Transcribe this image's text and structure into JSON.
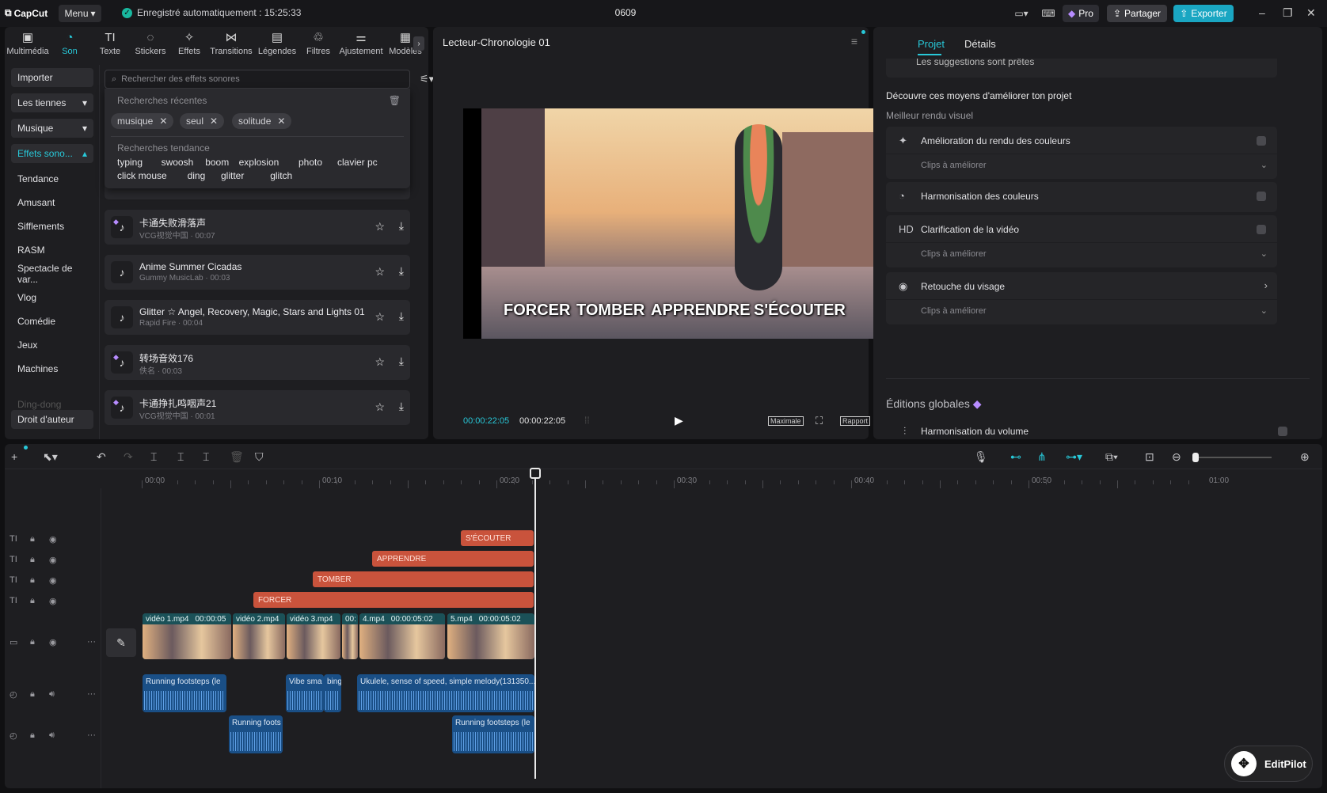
{
  "titlebar": {
    "logo": "CapCut",
    "menu": "Menu",
    "autosave": "Enregistré automatiquement : 15:25:33",
    "project": "0609",
    "pro": "Pro",
    "share": "Partager",
    "export": "Exporter",
    "min": "–",
    "restore": "❐",
    "close": "✕"
  },
  "tabs": [
    {
      "label": "Multimédia",
      "icon": "▣"
    },
    {
      "label": "Son",
      "icon": "◔"
    },
    {
      "label": "Texte",
      "icon": "TI"
    },
    {
      "label": "Stickers",
      "icon": "◌"
    },
    {
      "label": "Effets",
      "icon": "✧"
    },
    {
      "label": "Transitions",
      "icon": "⋈"
    },
    {
      "label": "Légendes",
      "icon": "▤"
    },
    {
      "label": "Filtres",
      "icon": "♲"
    },
    {
      "label": "Ajustement",
      "icon": "⚌"
    },
    {
      "label": "Modèles",
      "icon": "▦"
    }
  ],
  "sidebar": {
    "import": "Importer",
    "yours": "Les tiennes",
    "music": "Musique",
    "sfx": "Effets sono...",
    "cats": [
      "Tendance",
      "Amusant",
      "Sifflements",
      "RASM",
      "Spectacle de var...",
      "Vlog",
      "Comédie",
      "Jeux",
      "Machines"
    ],
    "faded": "Ding-dong",
    "copyright": "Droit d'auteur"
  },
  "search": {
    "placeholder": "Rechercher des effets sonores"
  },
  "dropdown": {
    "recent_title": "Recherches récentes",
    "recent": [
      "musique",
      "seul",
      "solitude"
    ],
    "trend_title": "Recherches tendance",
    "trend_row1": [
      "typing",
      "swoosh",
      "boom",
      "explosion",
      "photo",
      "clavier pc"
    ],
    "trend_row2": [
      "click mouse",
      "ding",
      "glitter",
      "glitch"
    ]
  },
  "sounds": [
    {
      "name": "卡通失败滑落声",
      "sub": "VCG视觉中国 · 00:07",
      "pro": true
    },
    {
      "name": "Anime Summer Cicadas",
      "sub": "Gummy MusicLab · 00:03",
      "pro": false
    },
    {
      "name": "Glitter ☆ Angel, Recovery, Magic, Stars and Lights 01",
      "sub": "Rapid Fire · 00:04",
      "pro": false
    },
    {
      "name": "转场音效176",
      "sub": "佚名 · 00:03",
      "pro": true
    },
    {
      "name": "卡通挣扎鸣咽声21",
      "sub": "VCG视觉中国 · 00:01",
      "pro": true
    }
  ],
  "player": {
    "title": "Lecteur-Chronologie 01",
    "current": "00:00:22:05",
    "total": "00:00:22:05",
    "ratio": "Maximale",
    "report": "Rapport",
    "captions": [
      "FORCER",
      "TOMBER",
      "APPRENDRE",
      "S'ÉCOUTER"
    ]
  },
  "right": {
    "tab_project": "Projet",
    "tab_details": "Détails",
    "top_text": "Les suggestions sont prêtes",
    "discover": "Découvre ces moyens d'améliorer ton projet",
    "visual": "Meilleur rendu visuel",
    "items": [
      {
        "label": "Amélioration du rendu des couleurs",
        "sub": "Clips à améliorer",
        "icon": "✦"
      },
      {
        "label": "Harmonisation des couleurs",
        "icon": "◔"
      },
      {
        "label": "Clarification de la vidéo",
        "sub": "Clips à améliorer",
        "icon": "HD"
      },
      {
        "label": "Retouche du visage",
        "sub": "Clips à améliorer",
        "icon": "◉"
      }
    ],
    "global": "Éditions globales",
    "volume": "Harmonisation du volume"
  },
  "timeline": {
    "ticks": [
      "00:00",
      "00:10",
      "00:20",
      "00:30",
      "00:40",
      "00:50",
      "01:00"
    ],
    "text_clips": [
      "S'ÉCOUTER",
      "APPRENDRE",
      "TOMBER",
      "FORCER"
    ],
    "video_clips": [
      {
        "h": "vidéo 1.mp4",
        "d": "00:00:05"
      },
      {
        "h": "vidéo 2.mp4",
        "d": ""
      },
      {
        "h": "vidéo 3.mp4",
        "d": ""
      },
      {
        "h": "00:",
        "d": ""
      },
      {
        "h": "4.mp4",
        "d": "00:00:05:02"
      },
      {
        "h": "5.mp4",
        "d": "00:00:05:02"
      }
    ],
    "audio_clips": [
      "Running footsteps (le",
      "Vibe sma",
      "bing",
      "Ukulele, sense of speed, simple melody(131350...",
      "Running foots",
      "Running footsteps (le"
    ]
  },
  "editpilot": "EditPilot"
}
